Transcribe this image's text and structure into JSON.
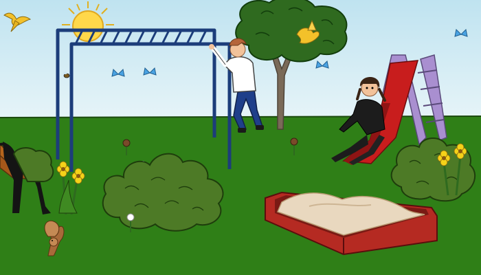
{
  "scene": {
    "colors": {
      "sky_top": "#bfe3f0",
      "sky_bottom": "#e6f4f8",
      "grass": "#2f7f17",
      "grass_dark": "#276c12",
      "monkey_bars": "#1c3d7a",
      "slide_red": "#c81d1d",
      "slide_frame": "#a98fd0",
      "sandbox_frame": "#b52a22",
      "sand": "#e9d8bf",
      "bush": "#4d7a26",
      "tree_foliage": "#2f6a1f",
      "tree_trunk": "#7a6a58",
      "sun": "#ffd84a"
    },
    "icons": [
      "sun-icon",
      "bird-icon",
      "butterfly-icon",
      "bee-icon",
      "squirrel-icon",
      "flower-icon"
    ]
  }
}
